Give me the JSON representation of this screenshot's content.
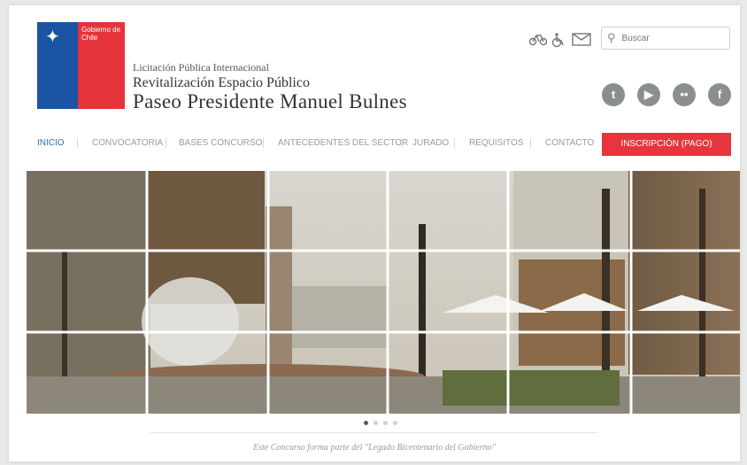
{
  "header": {
    "logo_text": "Gobierno de Chile",
    "title_line1": "Licitación Pública Internacional",
    "title_line2": "Revitalización  Espacio Público",
    "title_line3": "Paseo Presidente Manuel Bulnes"
  },
  "utility_icons": [
    "bicycle-icon",
    "wheelchair-icon",
    "mail-icon"
  ],
  "search": {
    "placeholder": "Buscar"
  },
  "social_icons": [
    "twitter-icon",
    "youtube-icon",
    "flickr-icon",
    "facebook-icon"
  ],
  "nav": {
    "items": [
      "INICIO",
      "CONVOCATORIA",
      "BASES CONCURSO",
      "ANTECEDENTES DEL SECTOR",
      "JURADO",
      "REQUISITOS",
      "CONTACTO"
    ],
    "cta": "INSCRIPCIÓN (PAGO)"
  },
  "slider": {
    "dot_count": 4,
    "active_index": 0
  },
  "footer": {
    "text": "Este Concurso forma parte del \"Legado Bicentenario del Gobierno\""
  },
  "colors": {
    "accent": "#e8343c",
    "blue": "#1b54a3",
    "nav_active": "#2f6db3"
  }
}
